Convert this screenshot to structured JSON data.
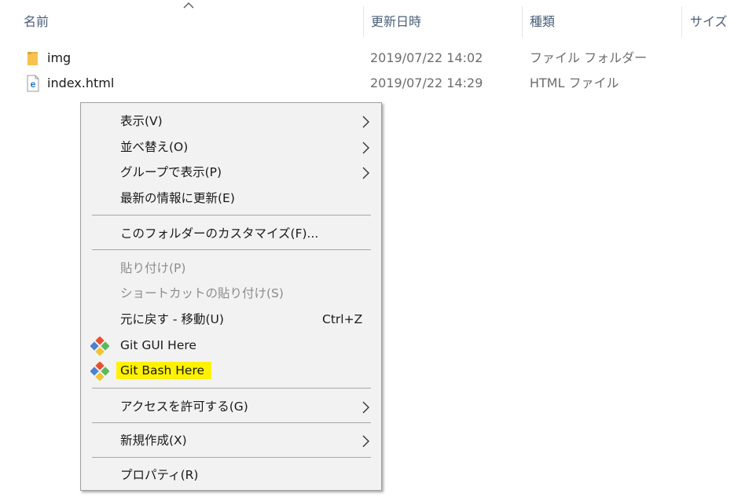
{
  "columns": {
    "name": "名前",
    "date": "更新日時",
    "type": "種類",
    "size": "サイズ"
  },
  "files": [
    {
      "icon": "folder-icon",
      "name": "img",
      "date": "2019/07/22 14:02",
      "type": "ファイル フォルダー"
    },
    {
      "icon": "edge-html-icon",
      "name": "index.html",
      "date": "2019/07/22 14:29",
      "type": "HTML ファイル"
    }
  ],
  "menu": {
    "view": "表示(V)",
    "sort": "並べ替え(O)",
    "group": "グループで表示(P)",
    "refresh": "最新の情報に更新(E)",
    "customize": "このフォルダーのカスタマイズ(F)...",
    "paste": "貼り付け(P)",
    "paste_shortcut": "ショートカットの貼り付け(S)",
    "undo_move": "元に戻す - 移動(U)",
    "undo_shortcut": "Ctrl+Z",
    "git_gui": "Git GUI Here",
    "git_bash": "Git Bash Here",
    "give_access": "アクセスを許可する(G)",
    "new": "新規作成(X)",
    "properties": "プロパティ(R)"
  },
  "colors": {
    "highlight": "#fff200",
    "header_text": "#4c607a",
    "menu_bg": "#f2f2f2",
    "folder": "#f5c34e",
    "git_red": "#e94e31",
    "git_blue": "#4f7fd1",
    "git_green": "#5cb85c",
    "git_yellow": "#f0c330"
  }
}
